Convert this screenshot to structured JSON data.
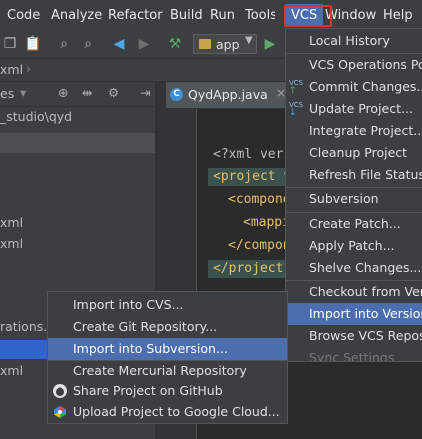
{
  "menubar": {
    "items": [
      "Code",
      "Analyze",
      "Refactor",
      "Build",
      "Run",
      "Tools",
      "VCS",
      "Window",
      "Help"
    ],
    "partial_left": ""
  },
  "toolbar": {
    "run_config": "app"
  },
  "nav": {
    "crumb": "xml"
  },
  "project_panel": {
    "header_label": "es",
    "tree": [
      "_studio\\qyd",
      "xml",
      "xml",
      "rations.x",
      "xml"
    ]
  },
  "editor": {
    "tab_label": "QydApp.java",
    "tab_icon": "C",
    "lines": [
      "<?xml vers",
      "<project v",
      "<compone",
      "<mappi",
      "</compon",
      "</project."
    ]
  },
  "vcs_menu": {
    "items": [
      {
        "label": "Local History",
        "icon": "",
        "state": "normal"
      },
      {
        "label": "VCS Operations Popup...",
        "icon": "",
        "state": "normal"
      },
      {
        "label": "Commit Changes...",
        "icon": "vcs-commit-icon",
        "state": "normal"
      },
      {
        "label": "Update Project...",
        "icon": "vcs-update-icon",
        "state": "normal"
      },
      {
        "label": "Integrate Project...",
        "icon": "",
        "state": "normal"
      },
      {
        "label": "Cleanup Project",
        "icon": "",
        "state": "normal"
      },
      {
        "label": "Refresh File Status",
        "icon": "",
        "state": "normal"
      },
      {
        "label": "Subversion",
        "icon": "",
        "state": "normal"
      },
      {
        "label": "Create Patch...",
        "icon": "",
        "state": "normal"
      },
      {
        "label": "Apply Patch...",
        "icon": "",
        "state": "normal"
      },
      {
        "label": "Shelve Changes...",
        "icon": "",
        "state": "normal"
      },
      {
        "label": "Checkout from Version Control",
        "icon": "",
        "state": "normal"
      },
      {
        "label": "Import into Version Control",
        "icon": "",
        "state": "selected"
      },
      {
        "label": "Browse VCS Repository",
        "icon": "",
        "state": "normal"
      },
      {
        "label": "Sync Settings",
        "icon": "",
        "state": "disabled"
      }
    ]
  },
  "import_menu": {
    "items": [
      {
        "label": "Import into CVS...",
        "icon": "",
        "state": "normal"
      },
      {
        "label": "Create Git Repository...",
        "icon": "",
        "state": "normal"
      },
      {
        "label": "Import into Subversion...",
        "icon": "",
        "state": "selected"
      },
      {
        "label": "Create Mercurial Repository",
        "icon": "",
        "state": "normal"
      },
      {
        "label": "Share Project on GitHub",
        "icon": "github-icon",
        "state": "normal"
      },
      {
        "label": "Upload Project to Google Cloud...",
        "icon": "google-cloud-icon",
        "state": "normal"
      }
    ]
  },
  "colors": {
    "selection": "#4b6eaf",
    "highlight_box": "#e03030",
    "background": "#2b2b2b"
  }
}
